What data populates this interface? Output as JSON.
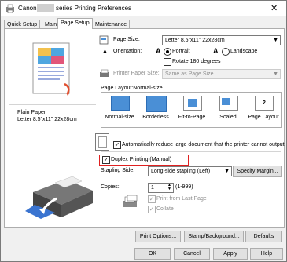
{
  "window": {
    "title_prefix": "Canon",
    "title_suffix": "series Printing Preferences",
    "close_glyph": "✕"
  },
  "tabs": [
    "Quick Setup",
    "Main",
    "Page Setup",
    "Maintenance"
  ],
  "preview": {
    "media_type": "Plain Paper",
    "paper_size": "Letter 8.5\"x11\" 22x28cm"
  },
  "page_size": {
    "label": "Page Size:",
    "value": "Letter 8.5\"x11\" 22x28cm"
  },
  "orientation": {
    "label": "Orientation:",
    "portrait": "Portrait",
    "landscape": "Landscape",
    "selected": "Portrait",
    "rotate_label": "Rotate 180 degrees"
  },
  "printer_paper_size": {
    "label": "Printer Paper Size:",
    "value": "Same as Page Size"
  },
  "page_layout": {
    "label": "Page Layout:Normal-size",
    "options": [
      "Normal-size",
      "Borderless",
      "Fit-to-Page",
      "Scaled",
      "Page Layout"
    ],
    "page_layout_icon_text": "2"
  },
  "auto_reduce": {
    "label": "Automatically reduce large document that the printer cannot output"
  },
  "duplex": {
    "label": "Duplex Printing (Manual)",
    "checked": true
  },
  "stapling": {
    "label": "Stapling Side:",
    "value": "Long-side stapling (Left)",
    "specify_margin": "Specify Margin..."
  },
  "copies": {
    "label": "Copies:",
    "value": "1",
    "range": "(1-999)",
    "print_last": "Print from Last Page",
    "collate": "Collate"
  },
  "bottom_buttons": {
    "print_options": "Print Options...",
    "stamp_background": "Stamp/Background...",
    "defaults": "Defaults"
  },
  "dialog_buttons": {
    "ok": "OK",
    "cancel": "Cancel",
    "apply": "Apply",
    "help": "Help"
  },
  "colors": {
    "accent": "#4a8fd6",
    "highlight_border": "#e02020"
  }
}
